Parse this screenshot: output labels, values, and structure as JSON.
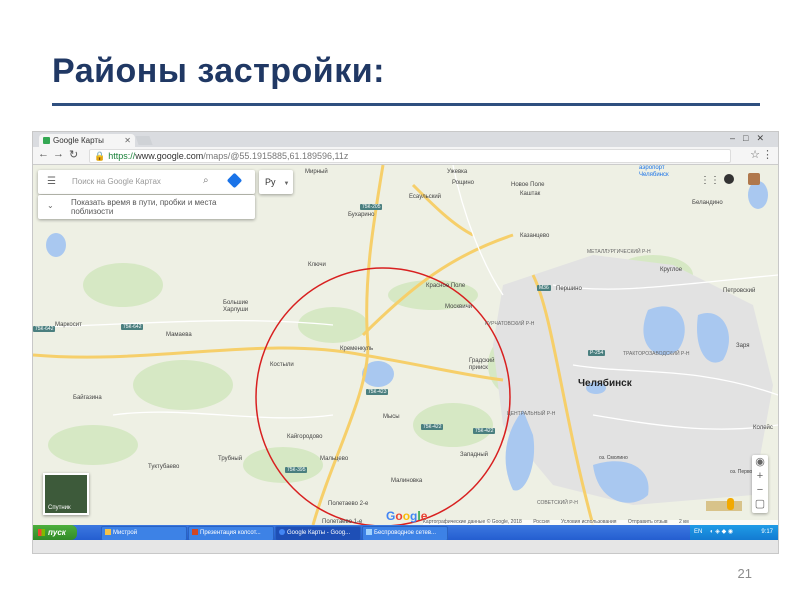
{
  "slide": {
    "title": "Районы застройки:",
    "page_number": "21"
  },
  "browser": {
    "tab_title": "Google Карты",
    "url_https": "https://",
    "url_host": "www.google.com",
    "url_path": "/maps/@55.1915885,61.189596,11z"
  },
  "map_ui": {
    "search_placeholder": "Поиск на Google Картах",
    "language": "Ру",
    "travel_hint": "Показать время в пути, пробки и места поблизости",
    "satellite_label": "Спутник",
    "google_logo": [
      "G",
      "o",
      "o",
      "g",
      "l",
      "e"
    ],
    "footer": [
      "Картографические данные © Google, 2018",
      "Россия",
      "Условия использования",
      "Отправить отзыв",
      "2 км"
    ]
  },
  "places": {
    "mirny": "Мирный",
    "uzhevka": "Ужевка",
    "roshchino": "Рощино",
    "novoe_pole": "Новое Поле",
    "kashtak": "Каштак",
    "esaulsky": "Есаульский",
    "bukharino": "Бухарино",
    "airport": "аэропорт Челябинск",
    "belandino": "Беландино",
    "kazantsevo": "Казанцево",
    "klyuchi": "Ключи",
    "krasnoe_pole": "Красное Поле",
    "pershino": "Першино",
    "kruglo": "Круглое",
    "petrovsky": "Петровский",
    "bolshie_kharlushi": "Большие Харлуши",
    "markosit": "Маркосит",
    "mamaeva": "Мамаева",
    "moskvichi": "Москвичи",
    "kremenkul": "Кременкуль",
    "gradsky_priisk": "Градский прииск",
    "chelyabinsk": "Челябинск",
    "zarya": "Заря",
    "kostyli": "Костыли",
    "baigazina": "Байгазина",
    "mysy": "Мысы",
    "kaigorodovo": "Кайгородово",
    "zapadny": "Западный",
    "koleisk": "Колейс",
    "trubny": "Трубный",
    "maltsevo": "Мальцево",
    "tuktubaevo": "Туктубаево",
    "malinovka": "Малиновка",
    "poletaevo2": "Полетаево 2-е",
    "poletaevo1": "Полетаево 1-е",
    "metall_district": "МЕТАЛЛУРГИЧЕСКИЙ Р-Н",
    "kurchat_district": "КУРЧАТОВСКИЙ Р-Н",
    "traktor_district": "ТРАКТОРОЗАВОДСКИЙ Р-Н",
    "central_district": "ЦЕНТРАЛЬНЫЙ Р-Н",
    "sovetsky_district": "СОВЕТСКИЙ Р-Н",
    "lake_pervoe": "оз. Первое",
    "lake_smolino": "оз. Смолино"
  },
  "roads": [
    "75К-205",
    "75К-642",
    "75К-642",
    "75К-423",
    "75К-422",
    "75К-422",
    "75К-395",
    "М36",
    "Р-254"
  ],
  "taskbar": {
    "start": "пуск",
    "tasks": [
      "Mистрой",
      "Презентация колсот...",
      "Google Карты - Goog...",
      "Беспроводное сетев..."
    ],
    "lang": "EN",
    "clock": "9:17"
  }
}
